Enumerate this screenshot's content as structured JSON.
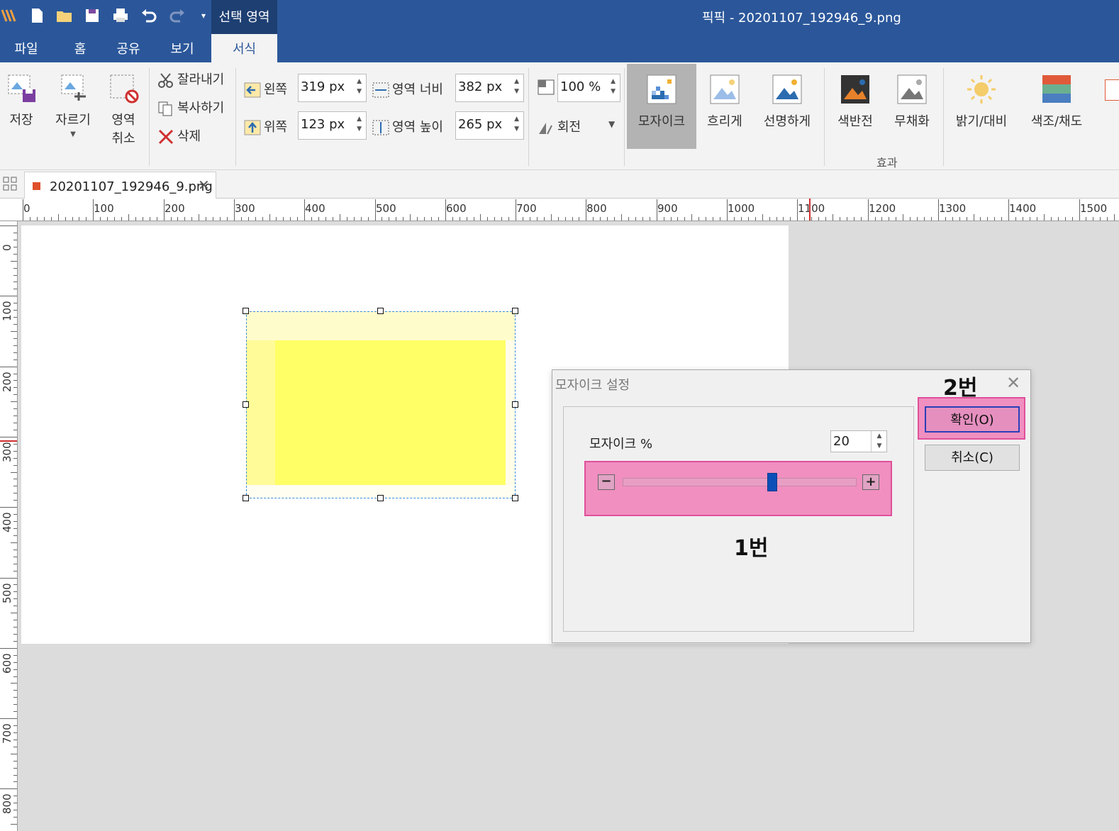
{
  "titlebar": {
    "context_tab": "선택 영역",
    "window_title": "픽픽 - 20201107_192946_9.png"
  },
  "quick_access": [
    "pen-logo-icon",
    "new-file-icon",
    "open-folder-icon",
    "save-disk-icon",
    "print-icon",
    "undo-icon",
    "redo-icon",
    "customize-dropdown-icon"
  ],
  "menu_tabs": [
    "파일",
    "홈",
    "공유",
    "보기",
    "서식"
  ],
  "ribbon": {
    "save_label": "저장",
    "crop_label": "자르기",
    "deselect_label_1": "영역",
    "deselect_label_2": "취소",
    "cut_label": "잘라내기",
    "copy_label": "복사하기",
    "delete_label": "삭제",
    "left_label": "왼쪽",
    "left_value": "319 px",
    "top_label": "위쪽",
    "top_value": "123 px",
    "width_label": "영역 너비",
    "width_value": "382 px",
    "height_label": "영역 높이",
    "height_value": "265 px",
    "zoom_value": "100 %",
    "rotate_label": "회전",
    "effects": [
      "모자이크",
      "흐리게",
      "선명하게",
      "색반전",
      "무채화",
      "밝기/대비",
      "색조/채도"
    ],
    "effects_group_label": "효과"
  },
  "document_tab": {
    "filename": "20201107_192946_9.png"
  },
  "rulers": {
    "h_labels": [
      "0",
      "100",
      "200",
      "300",
      "400",
      "500",
      "600",
      "700",
      "800",
      "900",
      "1000",
      "1100",
      "1200",
      "1300",
      "1400",
      "1500"
    ],
    "v_labels": [
      "0",
      "100",
      "200",
      "300",
      "400",
      "500",
      "600",
      "700",
      "800"
    ]
  },
  "dialog": {
    "title": "모자이크 설정",
    "mosaic_label": "모자이크 %",
    "mosaic_value": "20",
    "slider_level": 0.64,
    "ok_label": "확인(O)",
    "cancel_label": "취소(C)",
    "annotation_1": "1번",
    "annotation_2": "2번"
  },
  "colors": {
    "titlebar": "#2b579a",
    "highlight": "#f08fc0",
    "highlight_border": "#e0509a",
    "selection_fill": "#ffff66",
    "slider_thumb": "#0a4fb8"
  }
}
